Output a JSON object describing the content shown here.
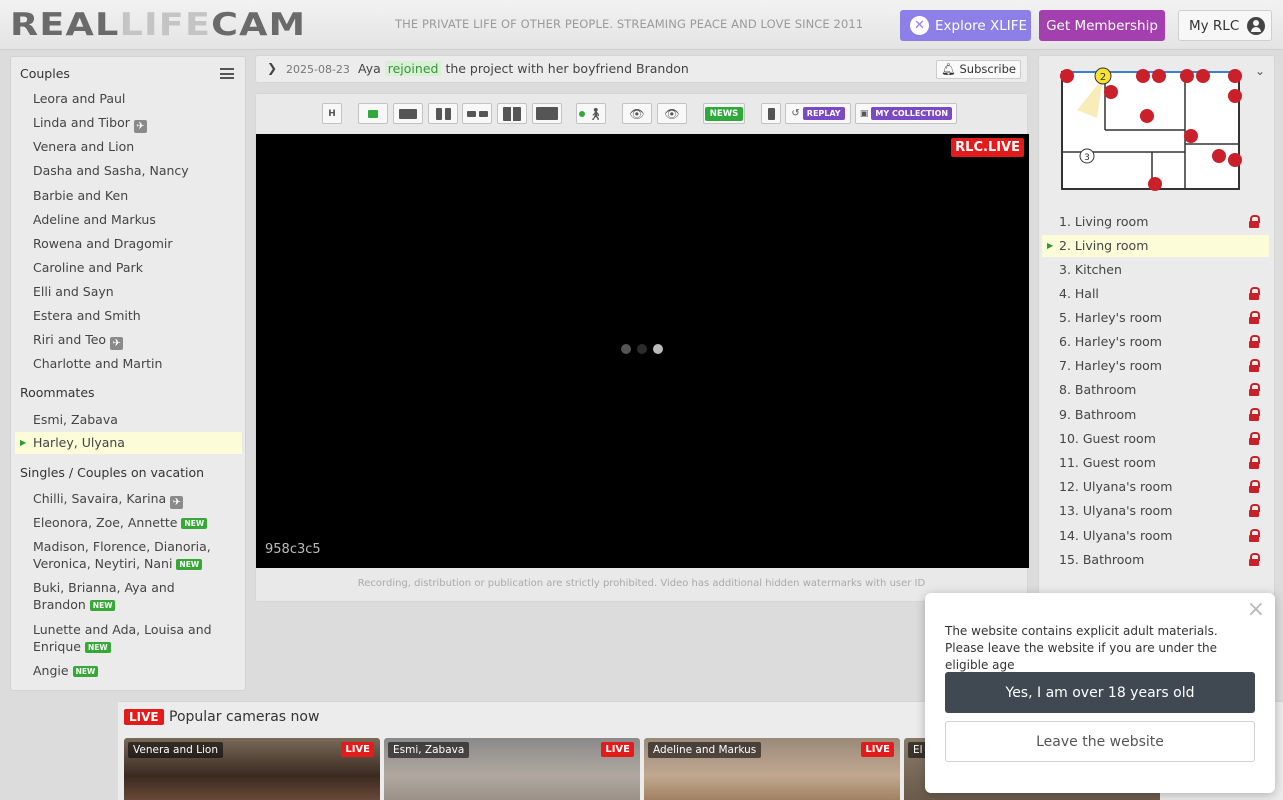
{
  "header": {
    "logo_part1": "REAL",
    "logo_part2": "LIFE",
    "logo_part3": "CAM",
    "tagline": "THE PRIVATE LIFE OF OTHER PEOPLE. STREAMING PEACE AND LOVE SINCE 2011",
    "explore_label": "Explore XLIFE",
    "membership_label": "Get Membership",
    "myrlc_label": "My RLC"
  },
  "sidebar": {
    "couples_title": "Couples",
    "couples": [
      "Leora and Paul",
      "Linda and Tibor",
      "Venera and Lion",
      "Dasha and Sasha, Nancy",
      "Barbie and Ken",
      "Adeline and Markus",
      "Rowena and Dragomir",
      "Caroline and Park",
      "Elli and Sayn",
      "Estera and Smith",
      "Riri and Teo",
      "Charlotte and Martin"
    ],
    "roommates_title": "Roommates",
    "roommates": [
      "Esmi, Zabava",
      "Harley, Ulyana"
    ],
    "singles_title": "Singles / Couples on vacation",
    "singles": [
      "Chilli, Savaira, Karina",
      "Eleonora, Zoe, Annette",
      "Madison, Florence, Dianoria,",
      "Veronica, Neytiri, Nani",
      "Buki, Brianna, Aya and",
      "Brandon",
      "Lunette and Ada, Louisa and",
      "Enrique",
      "Angie"
    ],
    "new_badge": "NEW"
  },
  "event": {
    "date": "2025-08-23",
    "name": "Aya",
    "action": "rejoined",
    "rest": "the project with her boyfriend",
    "partner": "Brandon",
    "subscribe_label": "Subscribe"
  },
  "toolbar": {
    "h_label": "H",
    "news_label": "NEWS",
    "replay_label": "REPLAY",
    "collection_label": "MY COLLECTION"
  },
  "player": {
    "live_badge": "RLC.LIVE",
    "watermark_id": "958c3c5",
    "warning": "Recording, distribution or publication are strictly prohibited. Video has additional hidden watermarks with user ID"
  },
  "rooms": [
    {
      "label": "1. Living room",
      "locked": true
    },
    {
      "label": "2. Living room",
      "locked": false,
      "active": true
    },
    {
      "label": "3. Kitchen",
      "locked": false
    },
    {
      "label": "4. Hall",
      "locked": true
    },
    {
      "label": "5. Harley's room",
      "locked": true
    },
    {
      "label": "6. Harley's room",
      "locked": true
    },
    {
      "label": "7. Harley's room",
      "locked": true
    },
    {
      "label": "8. Bathroom",
      "locked": true
    },
    {
      "label": "9. Bathroom",
      "locked": true
    },
    {
      "label": "10. Guest room",
      "locked": true
    },
    {
      "label": "11. Guest room",
      "locked": true
    },
    {
      "label": "12. Ulyana's room",
      "locked": true
    },
    {
      "label": "13. Ulyana's room",
      "locked": true
    },
    {
      "label": "14. Ulyana's room",
      "locked": true
    },
    {
      "label": "15. Bathroom",
      "locked": true
    }
  ],
  "floorplan": {
    "marker_active": "2",
    "marker_open": "3"
  },
  "popular": {
    "live_badge": "LIVE",
    "title": "Popular cameras now",
    "thumb_live": "LIVE",
    "thumbs": [
      "Venera and Lion",
      "Esmi, Zabava",
      "Adeline and Markus",
      "El"
    ]
  },
  "modal": {
    "text": "The website contains explicit adult materials. Please leave the website if you are under the eligible age",
    "yes_label": "Yes, I am over 18 years old",
    "leave_label": "Leave the website",
    "close_icon": "×"
  },
  "colors": {
    "accent_purple": "#a43fb0",
    "xlife": "#8e7ee8",
    "live_red": "#e31b1b",
    "new_green": "#36a836",
    "lock_red": "#c9202a"
  }
}
